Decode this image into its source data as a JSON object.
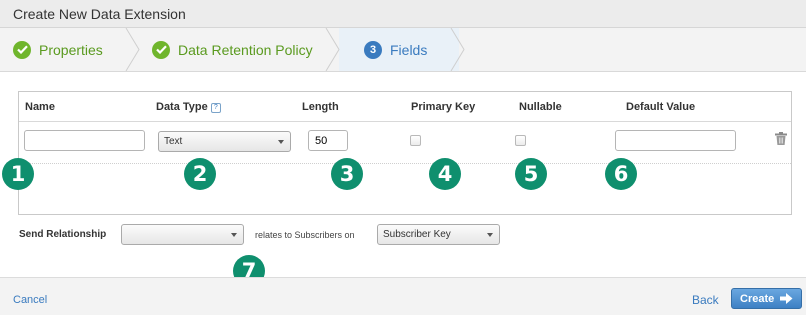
{
  "window": {
    "title": "Create New Data Extension"
  },
  "steps": [
    {
      "label": "Properties",
      "state": "done"
    },
    {
      "label": "Data Retention Policy",
      "state": "done"
    },
    {
      "label": "Fields",
      "state": "active",
      "number": "3"
    }
  ],
  "fields_table": {
    "columns": [
      "Name",
      "Data Type",
      "Length",
      "Primary Key",
      "Nullable",
      "Default Value"
    ],
    "help_icon": "?",
    "row": {
      "name_value": "",
      "data_type_value": "Text",
      "length_value": "50",
      "primary_key_checked": false,
      "nullable_checked": false,
      "default_value": ""
    }
  },
  "send_relationship": {
    "label": "Send Relationship",
    "left_select_value": "",
    "relates_text": "relates to Subscribers on",
    "right_select_value": "Subscriber Key"
  },
  "callouts": [
    "1",
    "2",
    "3",
    "4",
    "5",
    "6",
    "7"
  ],
  "footer": {
    "cancel_label": "Cancel",
    "back_label": "Back",
    "create_label": "Create"
  },
  "colors": {
    "accent": "#3a7bbf",
    "success": "#6fb52c",
    "callout": "#0f8f6e"
  }
}
